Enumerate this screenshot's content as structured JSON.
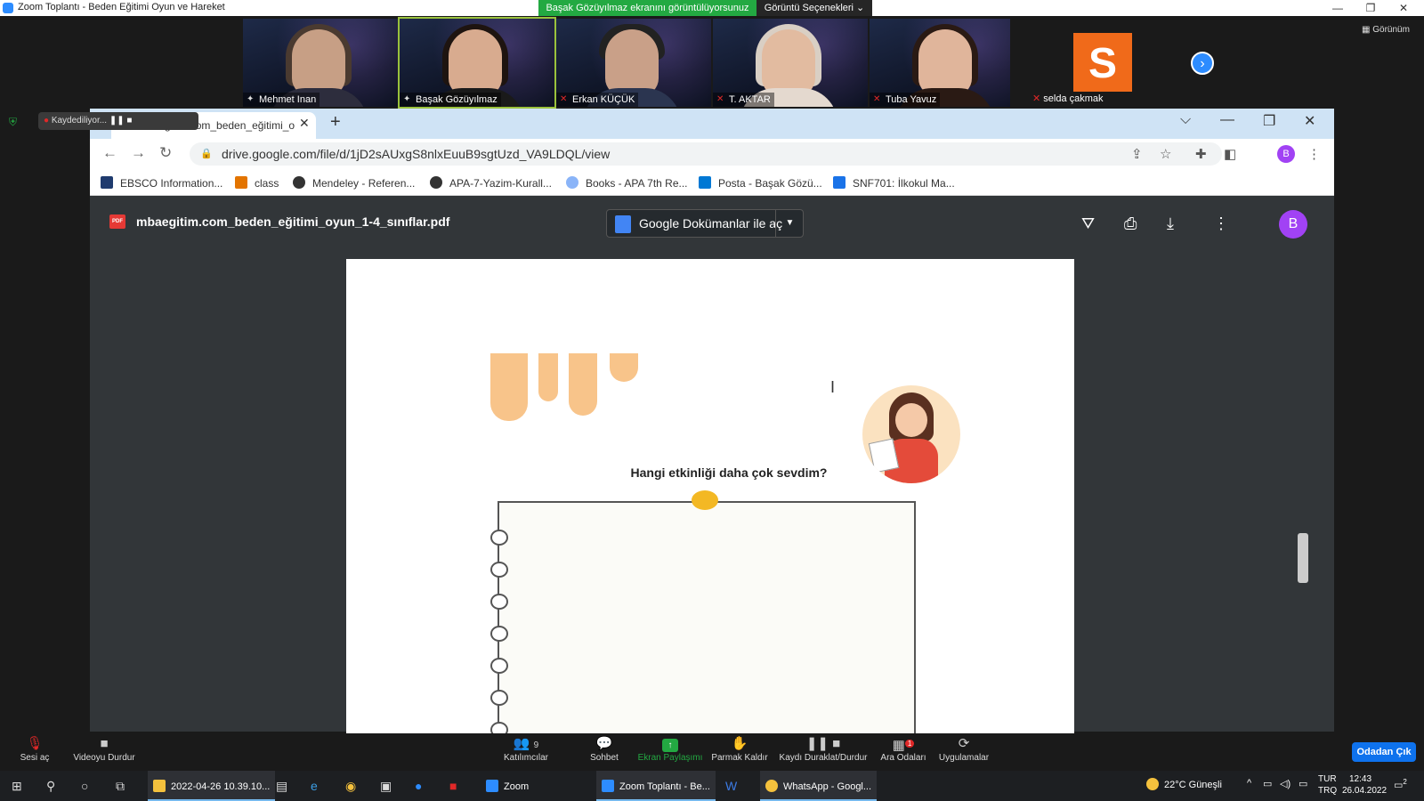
{
  "zoom": {
    "window_title": "Zoom Toplantı - Beden Eğitimi Oyun ve Hareket",
    "share_banner": "Başak Gözüyılmaz ekranını görüntülüyorsunuz",
    "view_options": "Görüntü Seçenekleri ⌄",
    "gallery_view": "Görünüm",
    "participants": [
      {
        "name": "Mehmet Inan"
      },
      {
        "name": "Başak Gözüyılmaz"
      },
      {
        "name": "Erkan KÜÇÜK"
      },
      {
        "name": "T. AKTAR"
      },
      {
        "name": "Tuba Yavuz"
      },
      {
        "name": "selda çakmak",
        "initial": "S",
        "avatar_color": "#f06a1a"
      }
    ],
    "toolbar": {
      "audio": "Sesi aç",
      "video": "Videoyu Durdur",
      "participants": "Katılımcılar",
      "participants_count": "9",
      "chat": "Sohbet",
      "share": "Ekran Paylaşımı",
      "raise_hand": "Parmak Kaldır",
      "record": "Kaydı Duraklat/Durdur",
      "breakout": "Ara Odaları",
      "breakout_badge": "1",
      "apps": "Uygulamalar",
      "leave": "Odadan Çık"
    }
  },
  "chrome": {
    "recording": "Kaydediliyor...",
    "tab_title": "mbaegitim.com_beden_eğitimi_o",
    "url": "drive.google.com/file/d/1jD2sAUxgS8nlxEuuB9sgtUzd_VA9LDQL/view",
    "profile_initial": "B",
    "bookmarks": [
      {
        "label": "EBSCO Information...",
        "color": "#1f3b6e"
      },
      {
        "label": "class",
        "color": "#e37400"
      },
      {
        "label": "Mendeley - Referen...",
        "color": "#333333"
      },
      {
        "label": "APA-7-Yazim-Kurall...",
        "color": "#333333"
      },
      {
        "label": "Books - APA 7th Re...",
        "color": "#8ab4f8"
      },
      {
        "label": "Posta - Başak Gözü...",
        "color": "#0078d4"
      },
      {
        "label": "SNF701: İlkokul Ma...",
        "color": "#1a73e8"
      }
    ]
  },
  "pdf": {
    "filename": "mbaegitim.com_beden_eğitimi_oyun_1-4_sınıflar.pdf",
    "open_with": "Google Dokümanlar ile aç",
    "avatar": "B",
    "question": "Hangi etkinliği daha çok sevdim?"
  },
  "taskbar": {
    "folder": "2022-04-26 10.39.10...",
    "zoom": "Zoom",
    "zoom_meeting": "Zoom Toplantı - Be...",
    "whatsapp": "WhatsApp - Googl...",
    "weather": "22°C  Güneşli",
    "lang": "TUR",
    "lang2": "TRQ",
    "time": "12:43",
    "date": "26.04.2022",
    "notif_count": "2"
  }
}
